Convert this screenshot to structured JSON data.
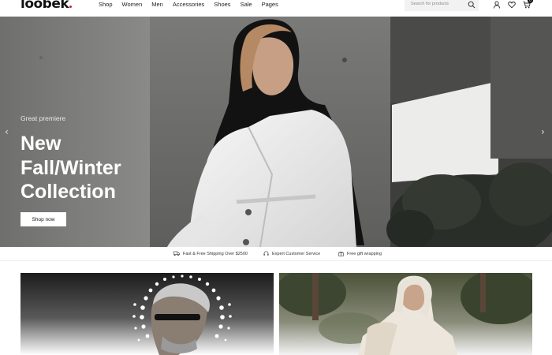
{
  "header": {
    "logo": "loobek",
    "nav": [
      "Shop",
      "Women",
      "Men",
      "Accessories",
      "Shoes",
      "Sale",
      "Pages"
    ],
    "search_placeholder": "Search for products",
    "cart_count": "0",
    "icons": [
      "search-icon",
      "user-icon",
      "heart-icon",
      "cart-icon"
    ]
  },
  "hero": {
    "eyebrow": "Great premiere",
    "title_lines": [
      "New",
      "Fall/Winter",
      "Collection"
    ],
    "button": "Shop now",
    "prev_arrow": "‹",
    "next_arrow": "›"
  },
  "features": [
    {
      "icon": "truck-icon",
      "text": "Fast & Free Shipping Over $2500"
    },
    {
      "icon": "headset-icon",
      "text": "Expert Customer Service"
    },
    {
      "icon": "gift-icon",
      "text": "Free gift wrapping"
    }
  ],
  "colors": {
    "accent_dot": "#d21e2b",
    "text": "#111111",
    "search_bg": "#f2f2f2"
  }
}
